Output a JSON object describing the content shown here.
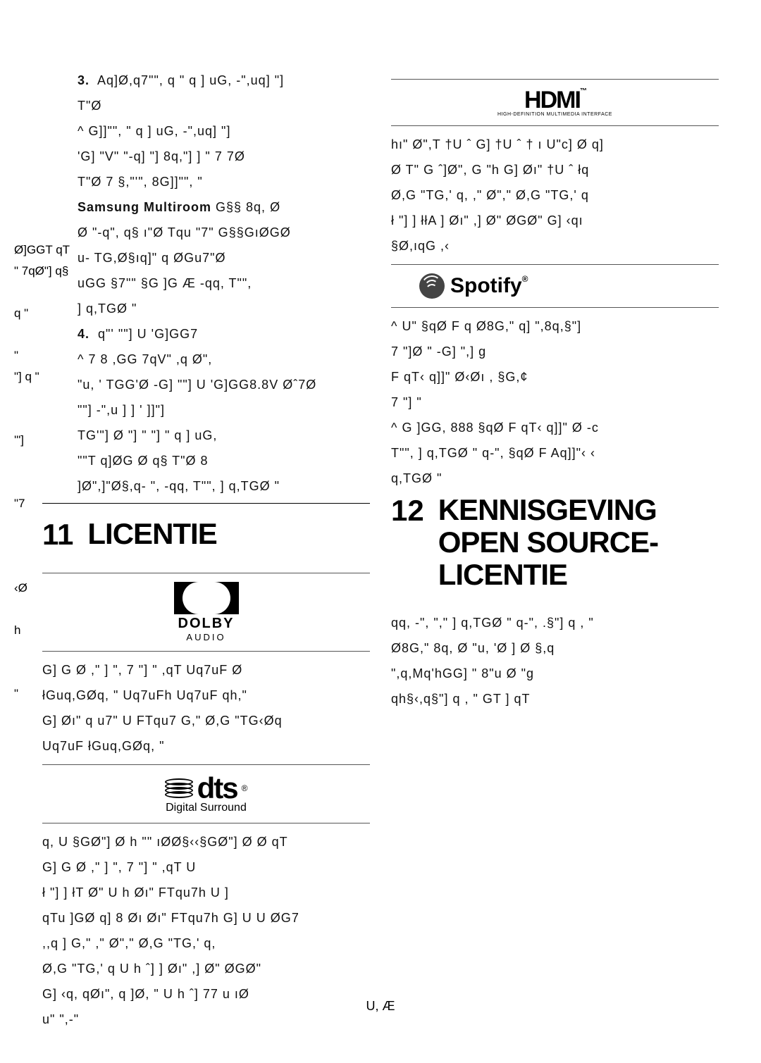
{
  "leftGutter": [
    "Ø]GGT qT",
    "\" 7qØ\"] q§",
    "",
    "q \"",
    "",
    "\"",
    "\"] q   \"",
    "",
    "",
    "'\"]",
    "",
    "",
    "\"7",
    "",
    "",
    "",
    "‹Ø",
    "",
    "   h",
    "",
    "",
    "\""
  ],
  "listNum3": "3.",
  "block3": [
    "Aq]Ø,q7\"\", q    \"  q ] uG, -\",uq] \"]",
    "T\"Ø",
    "^ G]]\"\",  \" q ] uG, -\",uq] \"]",
    "'G] \"V\" \"-q] \"] 8q,\"] ]  \" 7  7Ø",
    "T\"Ø 7   §,\"'\",  8G]]\"\",  \""
  ],
  "samsungLabel": "Samsung Multiroom",
  "samsungTail": " G§§ 8q, Ø",
  "block3b": [
    " Ø \"-q\",  q§ ı\"Ø Tqu \"7\" G§§GıØGØ",
    "u-    TG,Ø§ıq]\" q  ØGu7\"Ø",
    "uGG §7\"\" §G  ]G  Æ -qq, T\"\",",
    "] q,TGØ \""
  ],
  "listNum4": "4.",
  "block4": [
    "q\"' \"\"] U    'G]GG7",
    "^ 7   8  ,GG 7qV\" ,q Ø\",",
    "\"u,  ' TGG'Ø -G] \"\"] U  'G]GG8.8V Øˆ7Ø",
    "    \"\"]     -\",u ]  ] ' ]]\"]",
    "TG'\"] Ø  \"]  \"  \"]  \" q ] uG,",
    "  \"\"T  q]ØG  Ø q§ T\"Ø   8",
    "]Ø\",]\"Ø§,q-  \", -qq, T\"\", ] q,TGØ \""
  ],
  "hdmi": {
    "word": "HDMI",
    "tm": "™",
    "sub": "HIGH-DEFINITION MULTIMEDIA INTERFACE"
  },
  "rightTop": [
    "hı\" Ø\",T  †U ˆ G]  †U ˆ †  ı  U\"c] Ø q]",
    "Ø T\"  G ˆ]Ø\", G \"h G]  Øı\" †U ˆ łq",
    "Ø,G \"TG,' q, ,\"  Ø\",\"  Ø,G \"TG,'  q",
    " ł \"]  ] łłA  ] Øı\" ,] Ø\"   ØGØ\"  G] ‹qı",
    "§Ø,ıqG ,‹"
  ],
  "spotify": {
    "word": "Spotify",
    "r": "®"
  },
  "rightMid": [
    "^ U\"  §qØ  F q  Ø8G,\"   q] \",8q,§\"]",
    "7  \"]Ø \"  -G]  \",] g",
    "  F  qT‹ q]]\" Ø‹Øı ,  §G,¢",
    "7  \"]  \"",
    "^ G ]GG, 888 §qØ F qT‹ q]]\" Ø  -c",
    "T\"\", ] q,TGØ \" q-\", §qØ F Aq]]\"‹ ‹",
    "q,TGØ \""
  ],
  "sec11": {
    "num": "11",
    "title": "LICENTIE"
  },
  "dolby": {
    "word": "DOLBY",
    "sub": "AUDIO"
  },
  "dolbyText": [
    "G] G Ø ,\"  ]  \", 7 \"] \" ,qT Uq7uF Ø",
    "łGuq,GØq, \"   Uq7uFh Uq7uF    qh,\"",
    "G]  Øı\" q u7\" U FTqu7 G,\" Ø,G \"TG‹Øq",
    "Uq7uF łGuq,GØq, \""
  ],
  "dts": {
    "word": "dts",
    "r": "®",
    "sub": "Digital Surround"
  },
  "dtsText": [
    "q, U  §GØ\"] Ø h \"\" ıØØ§‹‹§GØ\"] Ø    Ø  qT",
    "G] G Ø  ,\" ] \", 7 \"] \" ,qT U",
    "ł \"] ] łT Ø\"   U h Øı\" FTqu7h U      ]",
    "qTu ]GØ q] 8 Øı Øı\" FTqu7h G] U    U    ØG7",
    ",,q ] G,\" ,\"  Ø\",\"  Ø,G \"TG,' q,",
    "Ø,G \"TG,'  q  U h ˆ]  ] Øı\" ,] Ø\"   ØGØ\"",
    "G]  ‹q, qØı\",  q ]Ø, \"     U h ˆ]  77 u ıØ",
    "u\" \",-\""
  ],
  "sec12": {
    "num": "12",
    "title": "KENNISGEVING OPEN SOURCE-LICENTIE"
  },
  "openSourceText": [
    "qq, -\", \",\" ] q,TGØ \" q-\", .§\"] q , \"",
    " Ø8G,\"   8q, Ø \"u, 'Ø ]   Ø §,q",
    " \",q,Mq'hGG] \" 8\"u  Ø \"g",
    "qh§‹,q§\"] q , \" GT ] qT"
  ],
  "footer": "U,   Æ"
}
